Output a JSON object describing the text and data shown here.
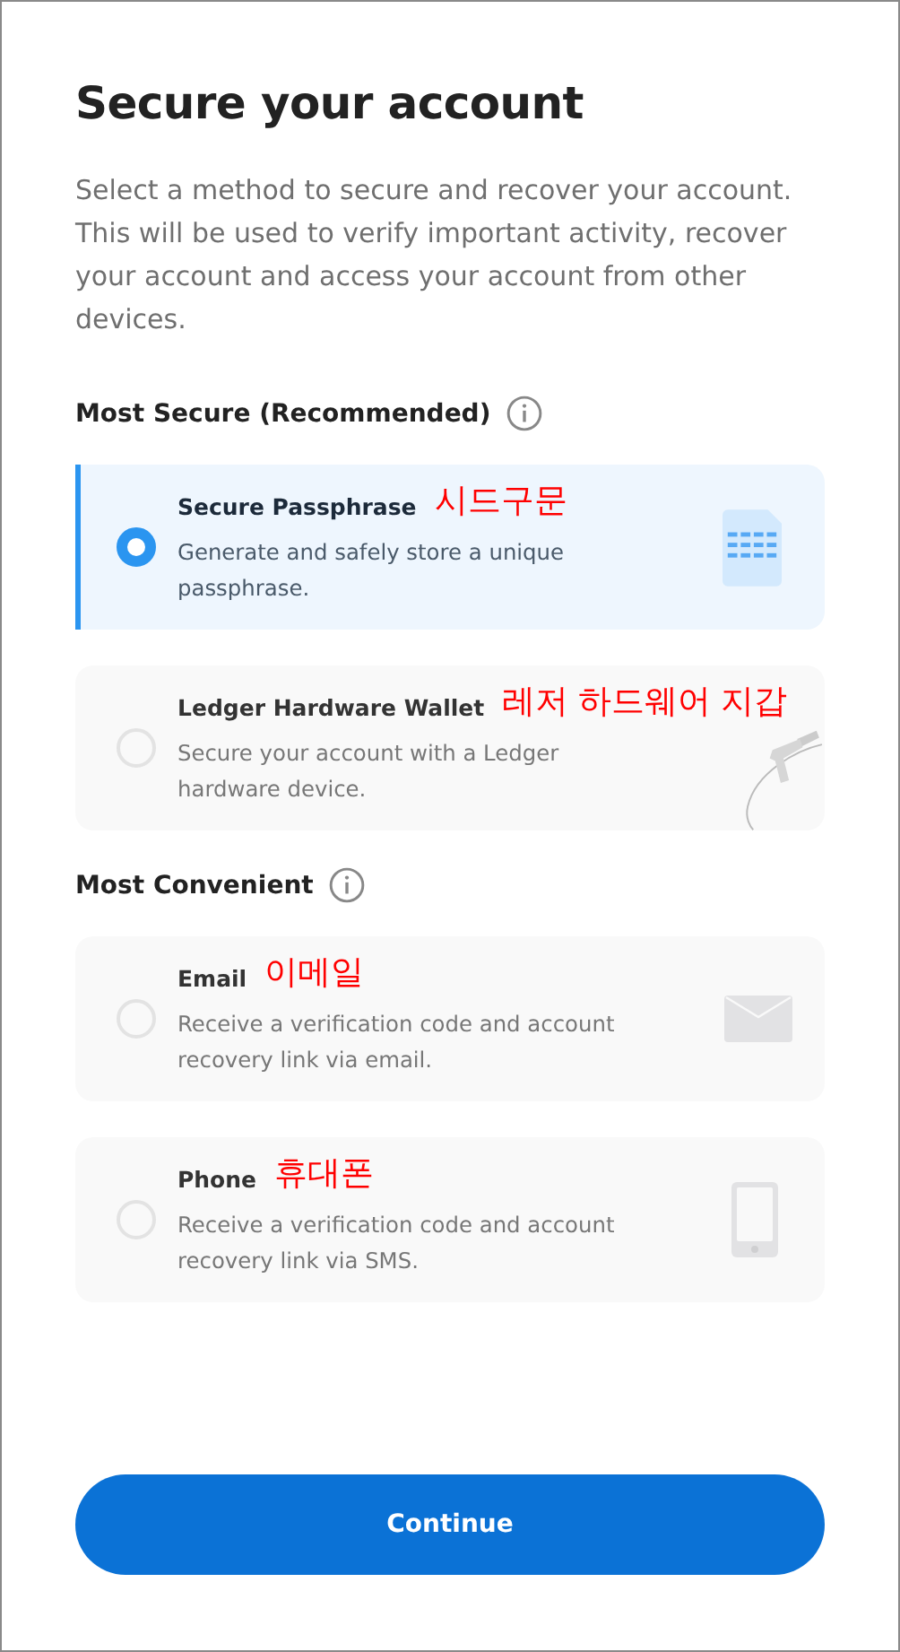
{
  "title": "Secure your account",
  "description": "Select a method to secure and recover your account. This will be used to verify important activity, recover your account and access your account from other devices.",
  "sections": [
    {
      "heading": "Most Secure (Recommended)",
      "options": [
        {
          "kind": "document",
          "title": "Secure Passphrase",
          "annotation": "시드구문",
          "description": "Generate and safely store a unique passphrase.",
          "selected": true
        },
        {
          "kind": "ledger",
          "title": "Ledger Hardware Wallet",
          "annotation": "레저 하드웨어 지갑",
          "description": "Secure your account with a Ledger hardware device.",
          "selected": false
        }
      ]
    },
    {
      "heading": "Most Convenient",
      "options": [
        {
          "kind": "mail",
          "title": "Email",
          "annotation": "이메일",
          "description": "Receive a verification code and account recovery link via email.",
          "selected": false
        },
        {
          "kind": "phone",
          "title": "Phone",
          "annotation": "휴대폰",
          "description": "Receive a verification code and account recovery link via SMS.",
          "selected": false
        }
      ]
    }
  ],
  "button": "Continue"
}
